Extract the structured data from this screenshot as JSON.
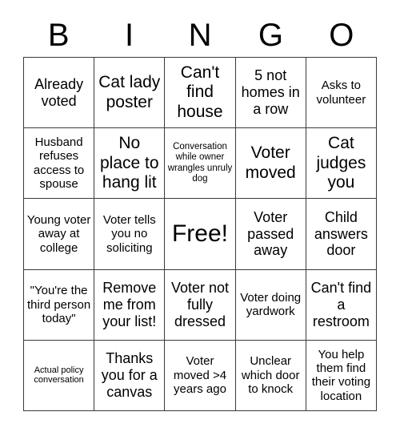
{
  "header": {
    "letters": [
      "B",
      "I",
      "N",
      "G",
      "O"
    ]
  },
  "grid": {
    "rows": 5,
    "cols": 5,
    "border_color": "#3a3a3a",
    "background_color": "#ffffff",
    "text_color": "#000000",
    "cells": [
      {
        "text": "Already voted",
        "size": "fs-md"
      },
      {
        "text": "Cat lady poster",
        "size": "fs-lg"
      },
      {
        "text": "Can't find house",
        "size": "fs-lg"
      },
      {
        "text": "5 not homes in a row",
        "size": "fs-md"
      },
      {
        "text": "Asks to volunteer",
        "size": "fs-sm"
      },
      {
        "text": "Husband refuses access to spouse",
        "size": "fs-sm"
      },
      {
        "text": "No place to hang lit",
        "size": "fs-lg"
      },
      {
        "text": "Conversation while owner wrangles unruly dog",
        "size": "fs-xs"
      },
      {
        "text": "Voter moved",
        "size": "fs-lg"
      },
      {
        "text": "Cat judges you",
        "size": "fs-lg"
      },
      {
        "text": "Young voter away at college",
        "size": "fs-sm"
      },
      {
        "text": "Voter tells you no soliciting",
        "size": "fs-sm"
      },
      {
        "text": "Free!",
        "size": "fs-xl"
      },
      {
        "text": "Voter passed away",
        "size": "fs-md"
      },
      {
        "text": "Child answers door",
        "size": "fs-md"
      },
      {
        "text": "\"You're the third person today\"",
        "size": "fs-sm"
      },
      {
        "text": "Remove me from your list!",
        "size": "fs-md"
      },
      {
        "text": "Voter not fully dressed",
        "size": "fs-md"
      },
      {
        "text": "Voter doing yardwork",
        "size": "fs-sm"
      },
      {
        "text": "Can't find a restroom",
        "size": "fs-md"
      },
      {
        "text": "Actual policy conversation",
        "size": "fs-xxs"
      },
      {
        "text": "Thanks you for a canvas",
        "size": "fs-md"
      },
      {
        "text": "Voter moved >4 years ago",
        "size": "fs-sm"
      },
      {
        "text": "Unclear which door to knock",
        "size": "fs-sm"
      },
      {
        "text": "You help them find their voting location",
        "size": "fs-sm"
      }
    ]
  }
}
